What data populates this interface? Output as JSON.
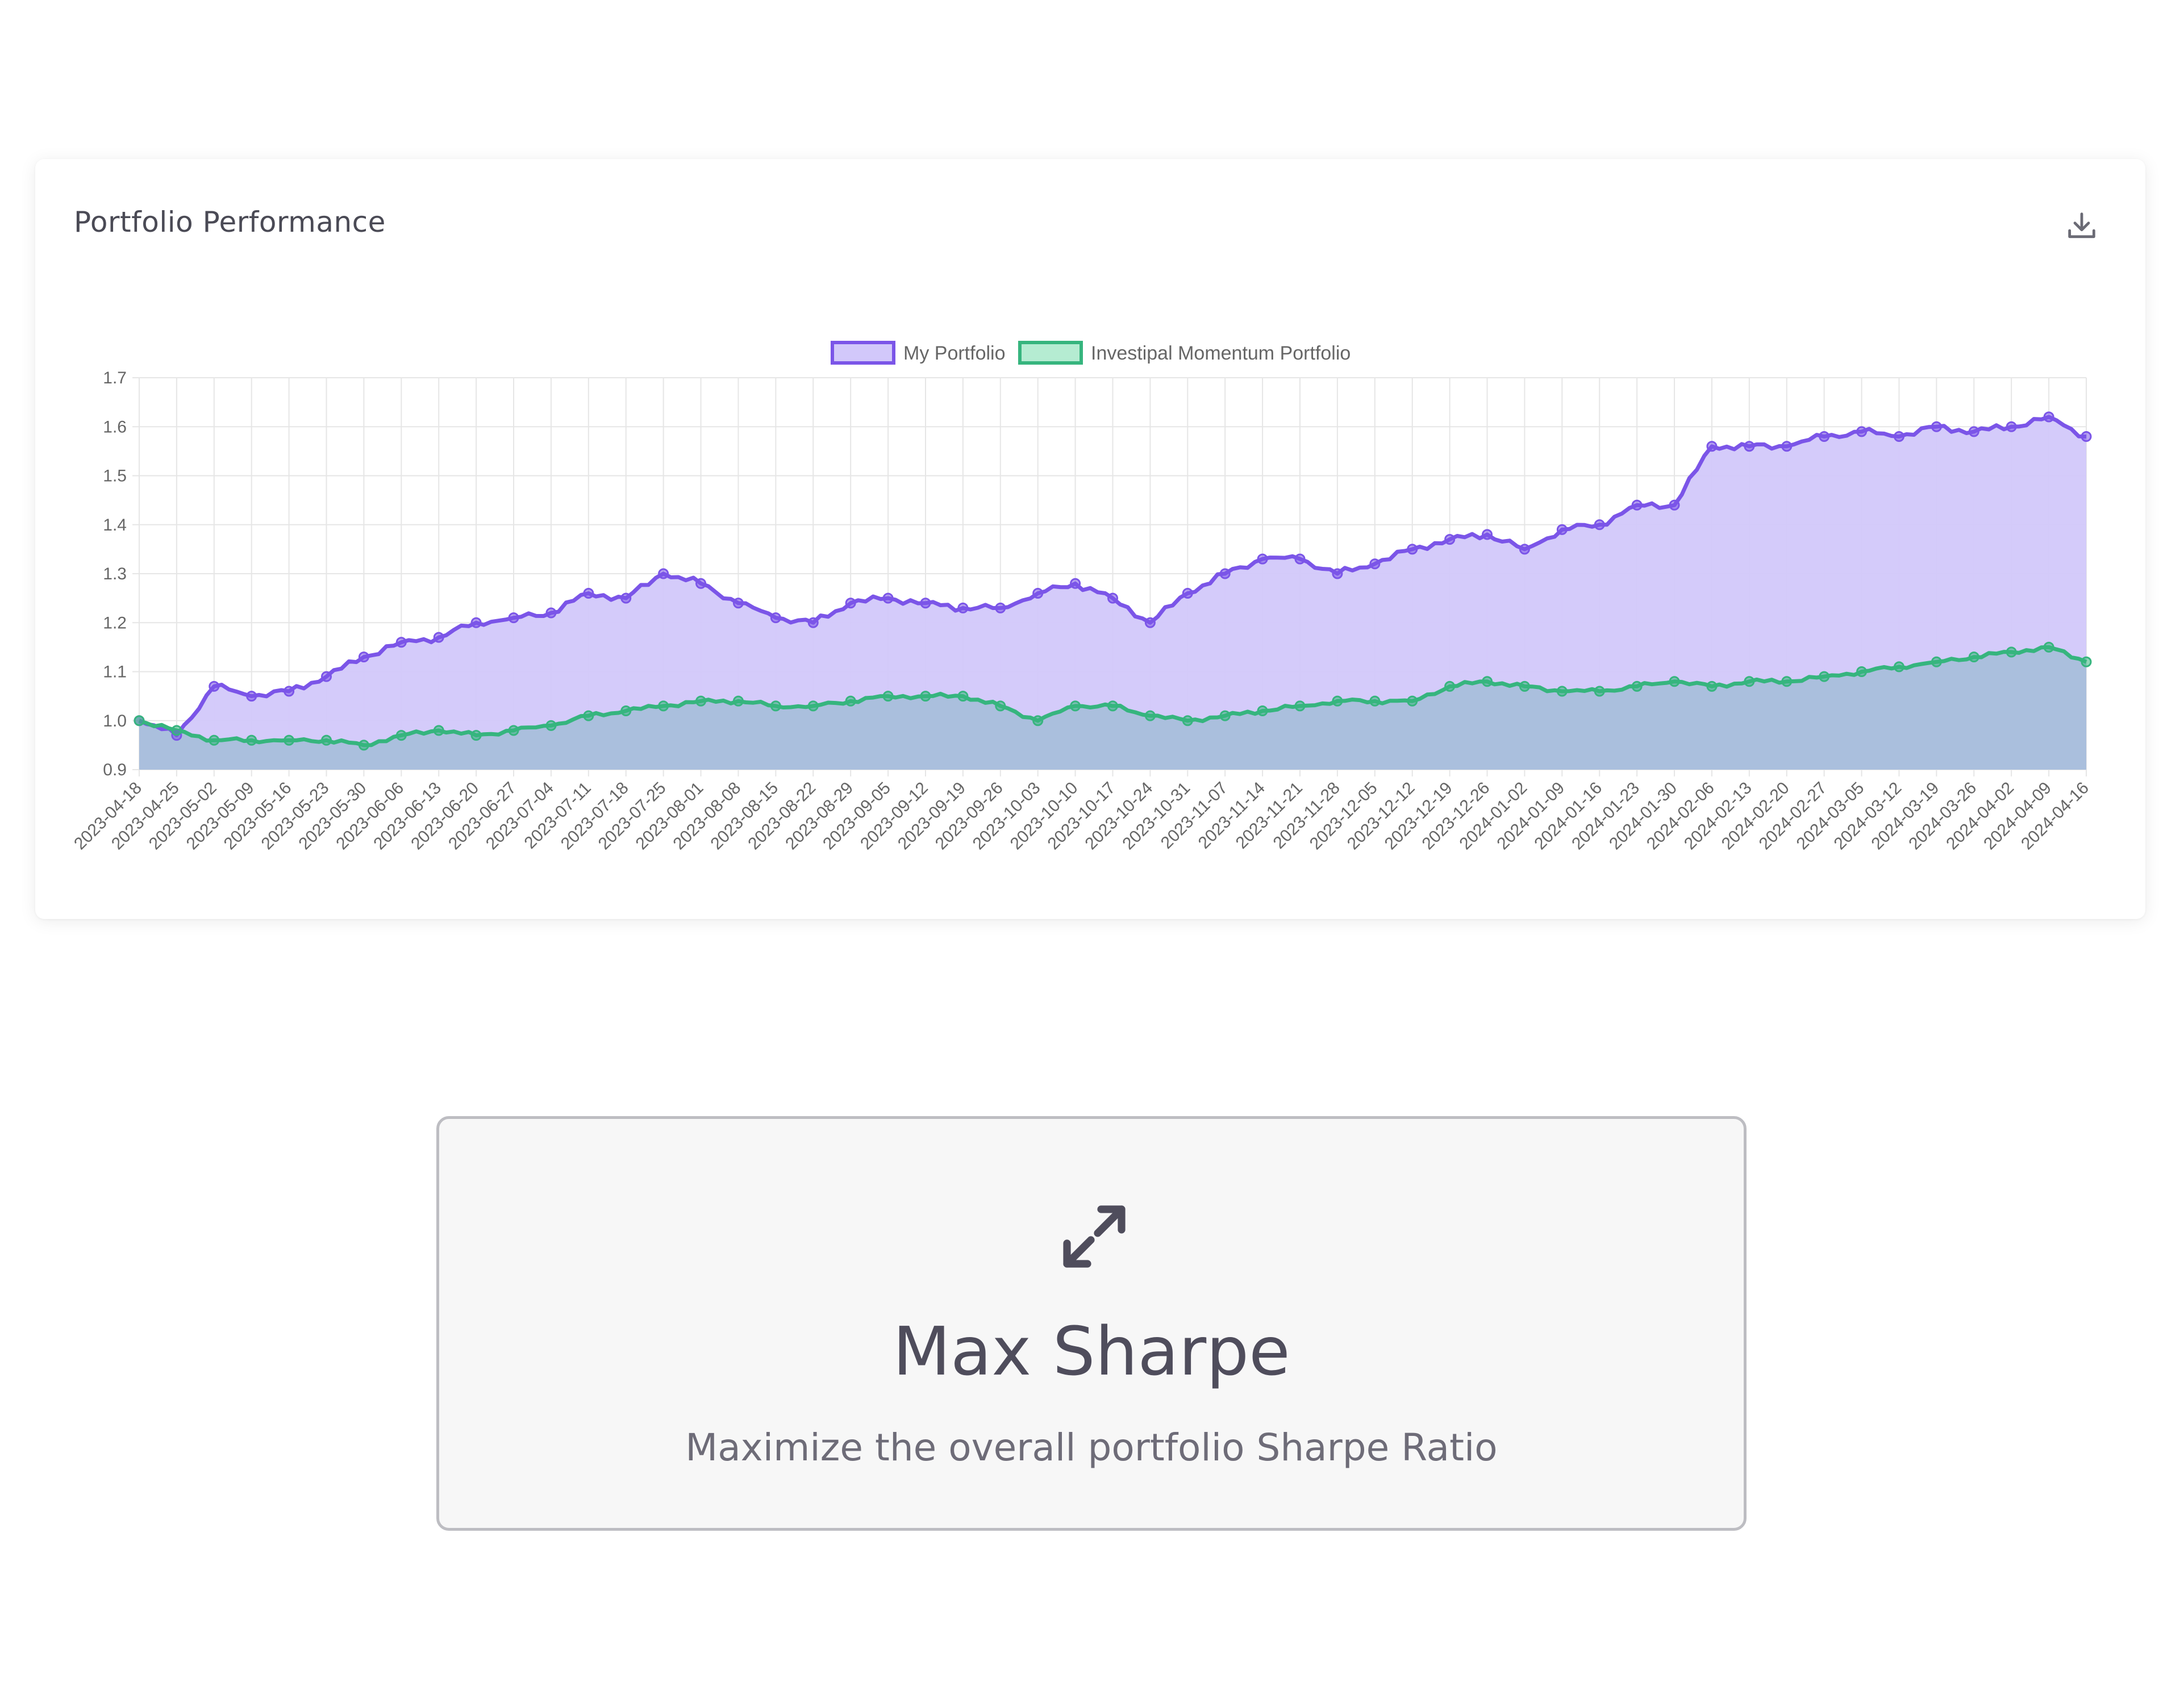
{
  "card": {
    "title": "Portfolio Performance",
    "download_icon": "download-icon"
  },
  "strategy": {
    "icon": "expand-arrows-icon",
    "title": "Max Sharpe",
    "subtitle": "Maximize the overall portfolio Sharpe Ratio"
  },
  "colors": {
    "portfolio_line": "#7b55e8",
    "portfolio_fill": "#d2c8fa",
    "momentum_line": "#36b57e",
    "momentum_fill": "#a8bedb",
    "grid": "#e6e6e6",
    "text": "#666666"
  },
  "chart_data": {
    "type": "area",
    "ylim": [
      0.9,
      1.7
    ],
    "yticks": [
      "1.7",
      "1.6",
      "1.5",
      "1.4",
      "1.3",
      "1.2",
      "1.1",
      "1.0",
      "0.9"
    ],
    "grid": true,
    "legend_position": "top-center",
    "categories": [
      "2023-04-18",
      "2023-04-25",
      "2023-05-02",
      "2023-05-09",
      "2023-05-16",
      "2023-05-23",
      "2023-05-30",
      "2023-06-06",
      "2023-06-13",
      "2023-06-20",
      "2023-06-27",
      "2023-07-04",
      "2023-07-11",
      "2023-07-18",
      "2023-07-25",
      "2023-08-01",
      "2023-08-08",
      "2023-08-15",
      "2023-08-22",
      "2023-08-29",
      "2023-09-05",
      "2023-09-12",
      "2023-09-19",
      "2023-09-26",
      "2023-10-03",
      "2023-10-10",
      "2023-10-17",
      "2023-10-24",
      "2023-10-31",
      "2023-11-07",
      "2023-11-14",
      "2023-11-21",
      "2023-11-28",
      "2023-12-05",
      "2023-12-12",
      "2023-12-19",
      "2023-12-26",
      "2024-01-02",
      "2024-01-09",
      "2024-01-16",
      "2024-01-23",
      "2024-01-30",
      "2024-02-06",
      "2024-02-13",
      "2024-02-20",
      "2024-02-27",
      "2024-03-05",
      "2024-03-12",
      "2024-03-19",
      "2024-03-26",
      "2024-04-02",
      "2024-04-09",
      "2024-04-16"
    ],
    "series": [
      {
        "name": "My Portfolio",
        "values": [
          1.0,
          0.97,
          1.07,
          1.05,
          1.06,
          1.09,
          1.13,
          1.16,
          1.17,
          1.2,
          1.21,
          1.22,
          1.26,
          1.25,
          1.3,
          1.28,
          1.24,
          1.21,
          1.2,
          1.24,
          1.25,
          1.24,
          1.23,
          1.23,
          1.26,
          1.28,
          1.25,
          1.2,
          1.26,
          1.3,
          1.33,
          1.33,
          1.3,
          1.32,
          1.35,
          1.37,
          1.38,
          1.35,
          1.39,
          1.4,
          1.44,
          1.44,
          1.56,
          1.56,
          1.56,
          1.58,
          1.59,
          1.58,
          1.6,
          1.59,
          1.6,
          1.62,
          1.58
        ]
      },
      {
        "name": "Investipal Momentum Portfolio",
        "values": [
          1.0,
          0.98,
          0.96,
          0.96,
          0.96,
          0.96,
          0.95,
          0.97,
          0.98,
          0.97,
          0.98,
          0.99,
          1.01,
          1.02,
          1.03,
          1.04,
          1.04,
          1.03,
          1.03,
          1.04,
          1.05,
          1.05,
          1.05,
          1.03,
          1.0,
          1.03,
          1.03,
          1.01,
          1.0,
          1.01,
          1.02,
          1.03,
          1.04,
          1.04,
          1.04,
          1.07,
          1.08,
          1.07,
          1.06,
          1.06,
          1.07,
          1.08,
          1.07,
          1.08,
          1.08,
          1.09,
          1.1,
          1.11,
          1.12,
          1.13,
          1.14,
          1.15,
          1.12
        ]
      }
    ]
  }
}
